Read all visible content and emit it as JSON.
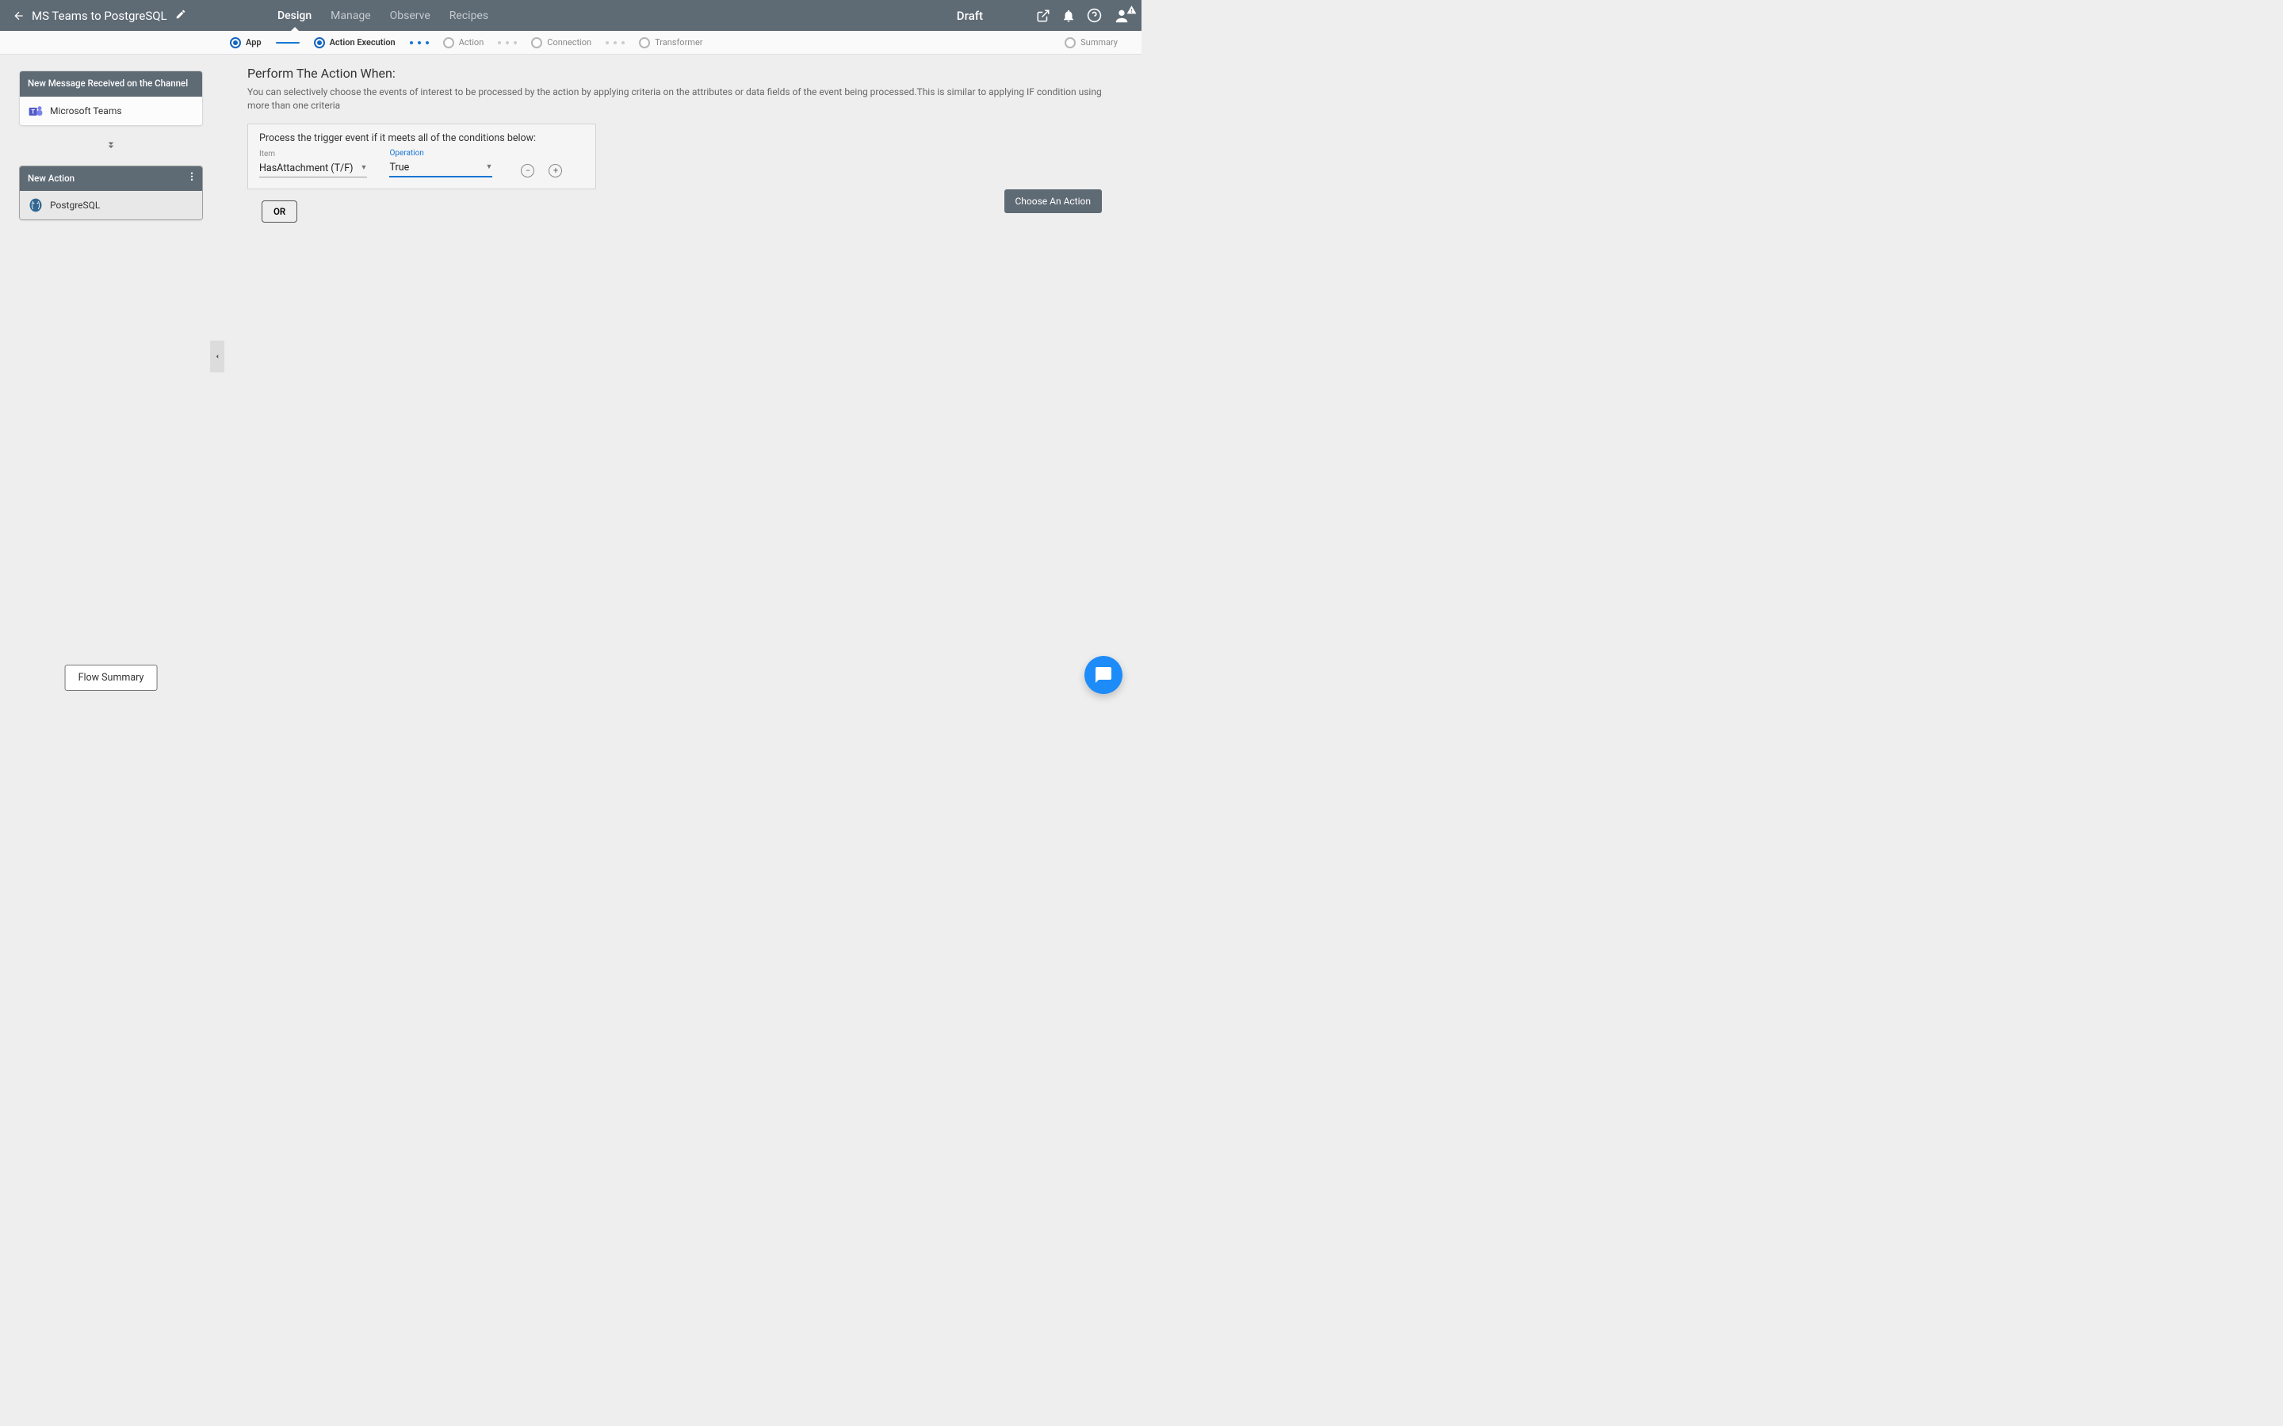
{
  "header": {
    "flow_title": "MS Teams to PostgreSQL",
    "tabs": [
      {
        "label": "Design",
        "active": true
      },
      {
        "label": "Manage",
        "active": false
      },
      {
        "label": "Observe",
        "active": false
      },
      {
        "label": "Recipes",
        "active": false
      }
    ],
    "status": "Draft"
  },
  "stepper": [
    {
      "label": "App",
      "state": "done"
    },
    {
      "label": "Action Execution",
      "state": "active"
    },
    {
      "label": "Action",
      "state": "pending"
    },
    {
      "label": "Connection",
      "state": "pending"
    },
    {
      "label": "Transformer",
      "state": "pending"
    },
    {
      "label": "Summary",
      "state": "pending"
    }
  ],
  "sidebar": {
    "cards": [
      {
        "title": "New Message Received on the Channel",
        "app_label": "Microsoft Teams",
        "icon": "teams-icon",
        "has_more": false
      },
      {
        "title": "New Action",
        "app_label": "PostgreSQL",
        "icon": "postgres-icon",
        "has_more": true,
        "shaded": true
      }
    ],
    "flow_summary_btn": "Flow Summary"
  },
  "content": {
    "section_title": "Perform The Action When:",
    "section_desc": "You can selectively choose the events of interest to be processed by the action by applying criteria on the attributes or data fields of the event being processed.This is similar to applying IF condition using more than one criteria",
    "condition_box_label": "Process the trigger event if it meets all of the conditions below:",
    "fields": {
      "item_label": "Item",
      "item_value": "HasAttachment (T/F)",
      "operation_label": "Operation",
      "operation_value": "True"
    },
    "or_button": "OR",
    "choose_action_btn": "Choose An Action"
  }
}
